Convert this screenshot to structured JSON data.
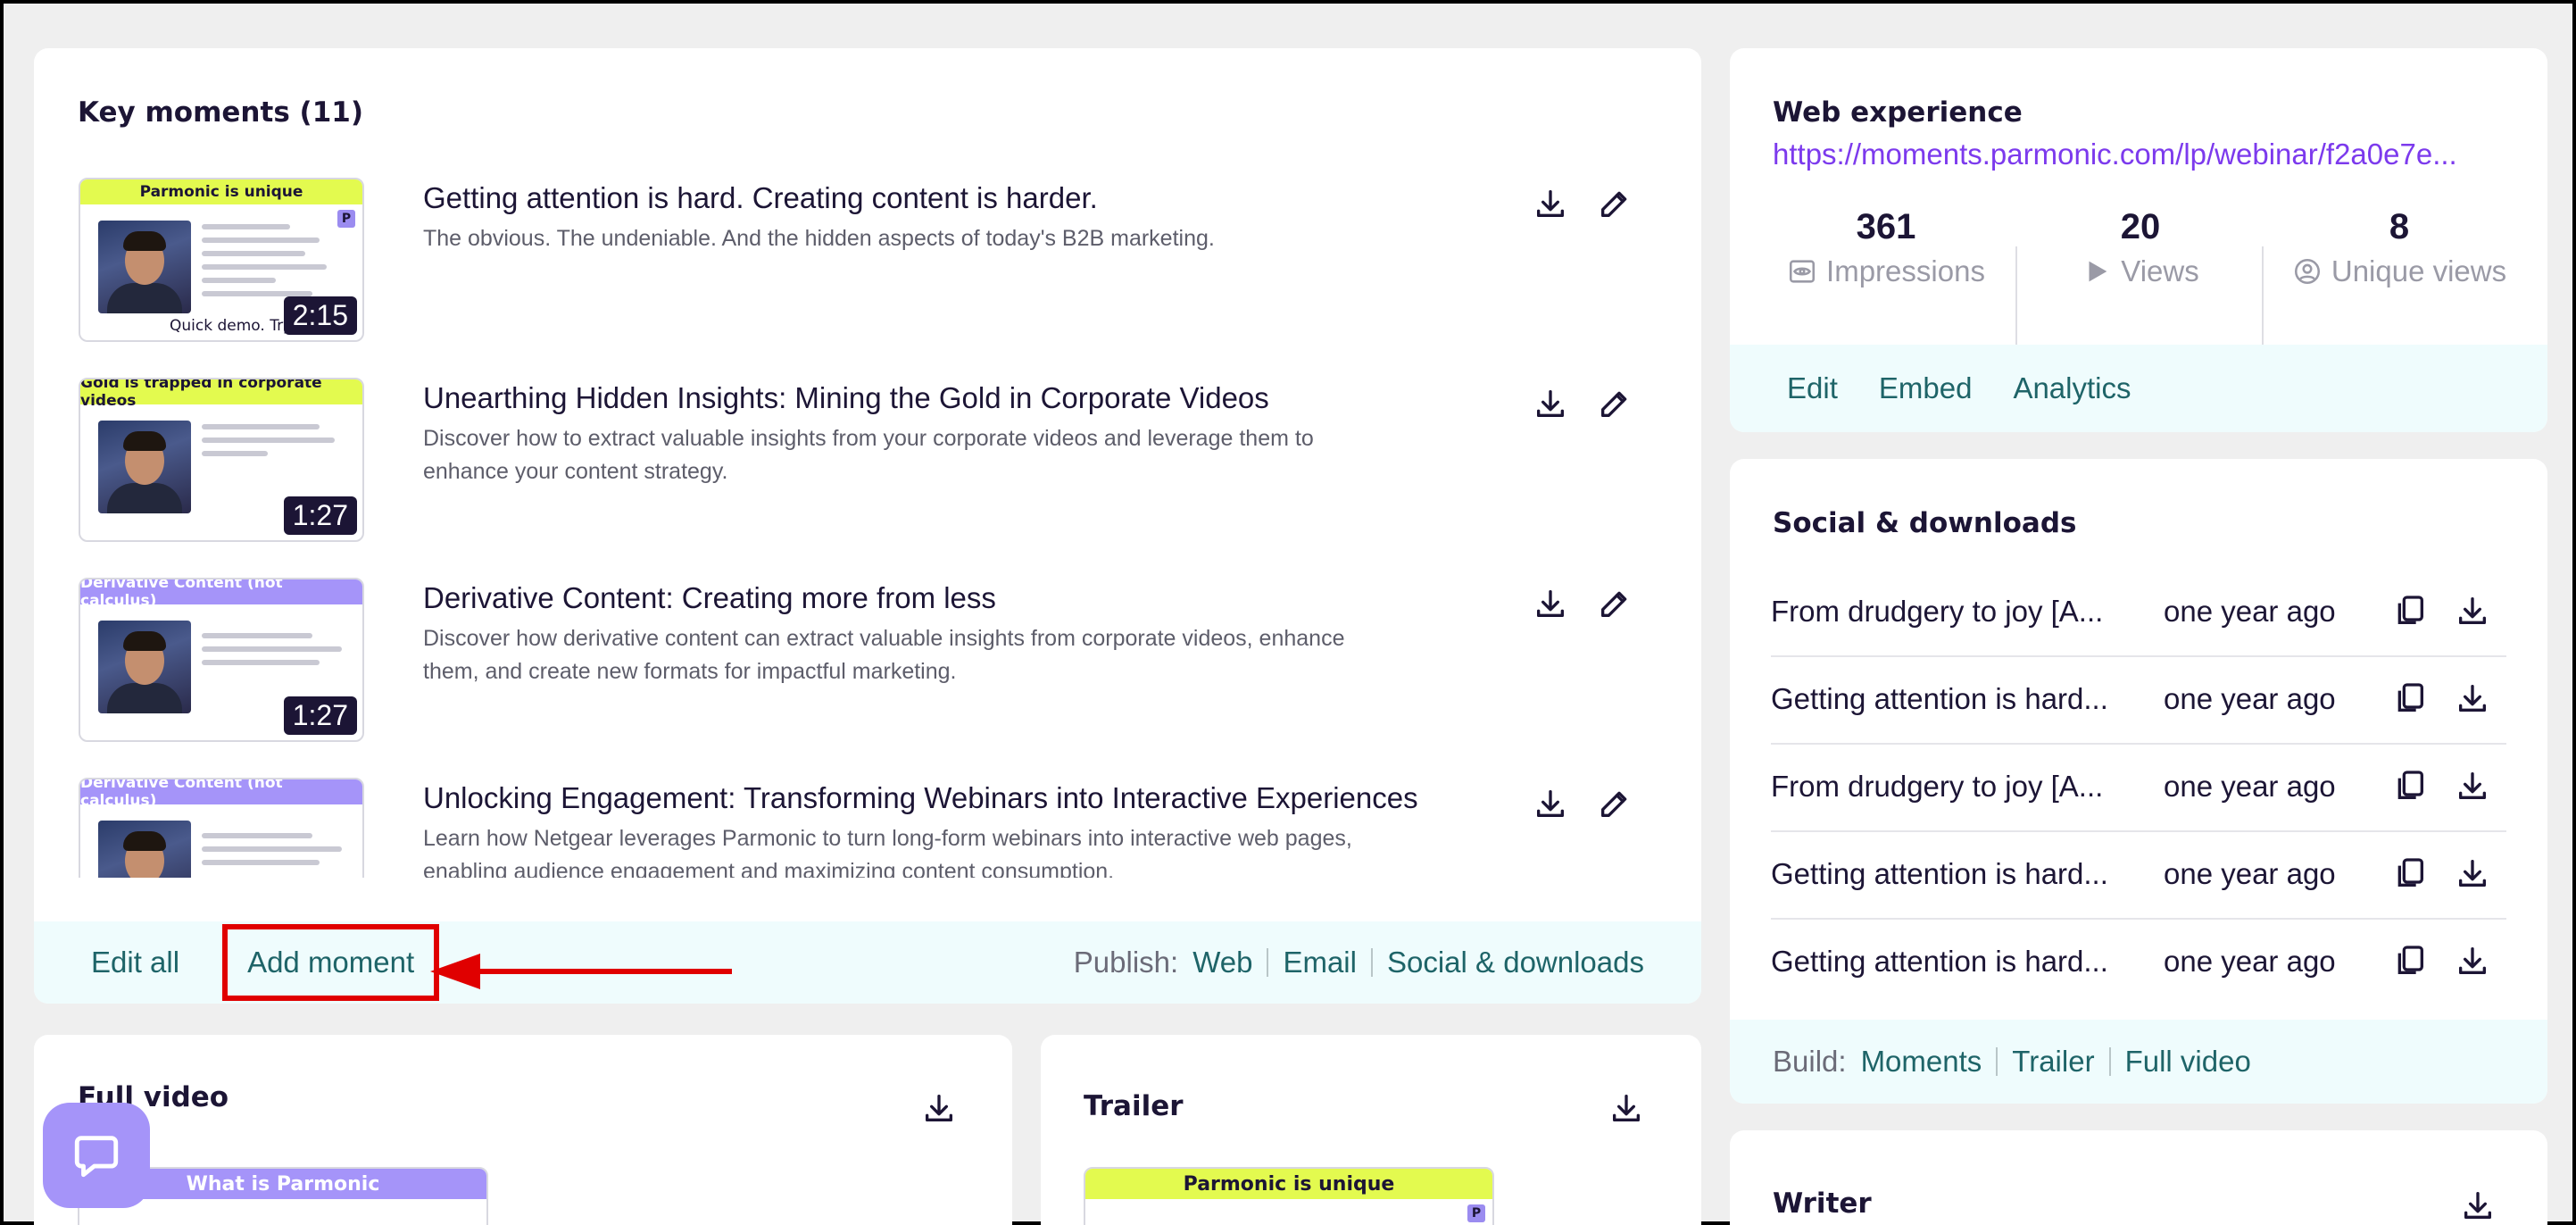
{
  "key_moments": {
    "title": "Key moments (11)",
    "items": [
      {
        "banner": "Parmonic is unique",
        "banner_color": "#e3fa4f",
        "duration": "2:15",
        "title": "Getting attention is hard. Creating content is harder.",
        "description": "The obvious. The undeniable. And the hidden aspects of today's B2B marketing.",
        "thumb_caption": "Quick demo. Try it out"
      },
      {
        "banner": "Gold is trapped in corporate videos",
        "banner_color": "#e3fa4f",
        "duration": "1:27",
        "title": "Unearthing Hidden Insights: Mining the Gold in Corporate Videos",
        "description": "Discover how to extract valuable insights from your corporate videos and leverage them to enhance your content strategy."
      },
      {
        "banner": "Derivative Content (not calculus)",
        "banner_color": "#a594f9",
        "duration": "1:27",
        "title": "Derivative Content: Creating more from less",
        "description": "Discover how derivative content can extract valuable insights from corporate videos, enhance them, and create new formats for impactful marketing."
      },
      {
        "banner": "Derivative Content (not calculus)",
        "banner_color": "#a594f9",
        "duration": "",
        "title": "Unlocking Engagement: Transforming Webinars into Interactive Experiences",
        "description": "Learn how Netgear leverages Parmonic to turn long-form webinars into interactive web pages, enabling audience engagement and maximizing content consumption."
      }
    ],
    "footer": {
      "edit_all": "Edit all",
      "add_moment": "Add moment",
      "publish_label": "Publish:",
      "publish_links": [
        "Web",
        "Email",
        "Social & downloads"
      ]
    }
  },
  "web_experience": {
    "title": "Web experience",
    "url": "https://moments.parmonic.com/lp/webinar/f2a0e7e...",
    "stats": [
      {
        "value": "361",
        "label": "Impressions",
        "icon": "eye-icon"
      },
      {
        "value": "20",
        "label": "Views",
        "icon": "play-icon"
      },
      {
        "value": "8",
        "label": "Unique views",
        "icon": "user-circle-icon"
      }
    ],
    "actions": [
      "Edit",
      "Embed",
      "Analytics"
    ]
  },
  "social_downloads": {
    "title": "Social & downloads",
    "rows": [
      {
        "name": "From drudgery to joy [A...",
        "date": "one year ago"
      },
      {
        "name": "Getting attention is hard...",
        "date": "one year ago"
      },
      {
        "name": "From drudgery to joy [A...",
        "date": "one year ago"
      },
      {
        "name": "Getting attention is hard...",
        "date": "one year ago"
      },
      {
        "name": "Getting attention is hard...",
        "date": "one year ago"
      }
    ],
    "footer": {
      "build_label": "Build:",
      "build_links": [
        "Moments",
        "Trailer",
        "Full video"
      ]
    }
  },
  "full_video": {
    "title": "Full video",
    "banner": "What is Parmonic"
  },
  "trailer": {
    "title": "Trailer",
    "banner": "Parmonic is unique"
  },
  "writer": {
    "title": "Writer"
  },
  "colors": {
    "accent_link": "#7c3aed",
    "teal": "#1e6468",
    "highlight_red": "#e00000",
    "chat_bubble": "#a594f9"
  }
}
